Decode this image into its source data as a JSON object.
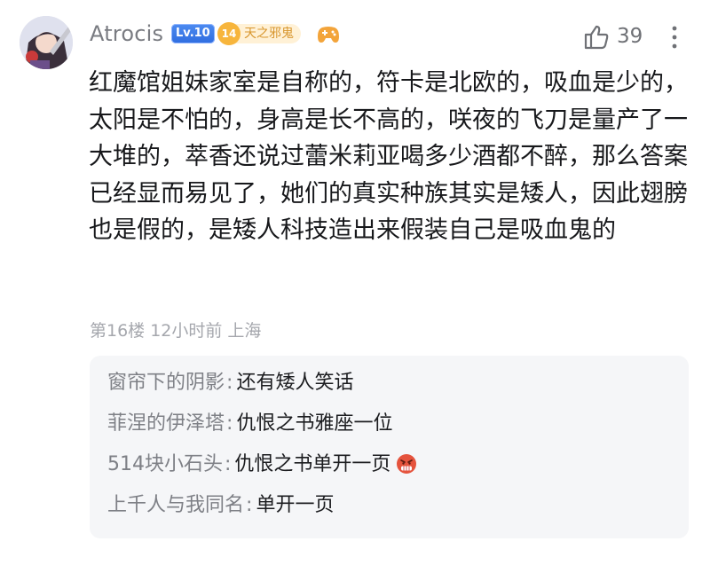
{
  "comment": {
    "username": "Atrocis",
    "level": "Lv.10",
    "title_badge": {
      "number": "14",
      "label": "天之邪鬼"
    },
    "like_count": "39",
    "text": "红魔馆姐妹家室是自称的，符卡是北欧的，吸血是少的，太阳是不怕的，身高是长不高的，咲夜的飞刀是量产了一大堆的，萃香还说过蕾米莉亚喝多少酒都不醉，那么答案已经显而易见了，她们的真实种族其实是矮人，因此翅膀也是假的，是矮人科技造出来假装自己是吸血鬼的",
    "meta": "第16楼 12小时前 上海"
  },
  "replies": [
    {
      "name": "窗帘下的阴影",
      "sep": ":",
      "text": "还有矮人笑话"
    },
    {
      "name": "菲涅的伊泽塔",
      "sep": ":",
      "text": "仇恨之书雅座一位"
    },
    {
      "name": "514块小石头",
      "sep": ":",
      "text": "仇恨之书单开一页",
      "emoji": "angry-face-emoji"
    },
    {
      "name": "上千人与我同名",
      "sep": ":",
      "text": "单开一页"
    }
  ],
  "colors": {
    "level_badge": "#2f6de0",
    "title_badge_text": "#d8962d",
    "meta_text": "#a5a7ad"
  }
}
